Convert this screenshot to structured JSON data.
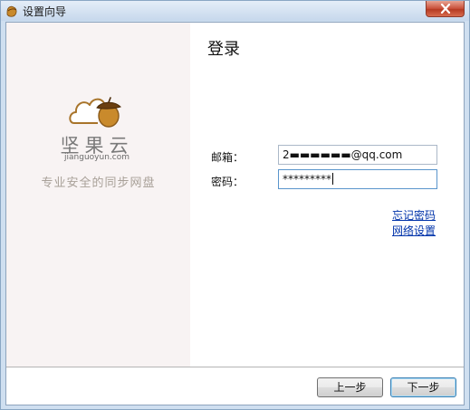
{
  "window": {
    "title": "设置向导"
  },
  "brand": {
    "name": "坚果云",
    "url": "jianguoyun.com",
    "tagline": "专业安全的同步网盘"
  },
  "login": {
    "heading": "登录",
    "email_label": "邮箱：",
    "email_value": "2▬▬▬▬▬▬@qq.com",
    "password_label": "密码：",
    "password_value": "*********"
  },
  "links": {
    "forgot_password": "忘记密码",
    "network_settings": "网络设置"
  },
  "buttons": {
    "back": "上一步",
    "next": "下一步"
  },
  "colors": {
    "link": "#0033aa",
    "left_panel_bg": "#f8f3f3",
    "logo_brown": "#a8742a"
  }
}
